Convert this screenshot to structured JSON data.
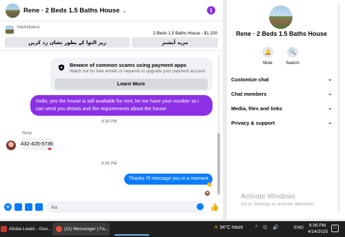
{
  "chat": {
    "title": "Rene · 2 Beds 1.5 Baths House",
    "chevron": "⌄",
    "info_icon": "i",
    "marketplace_label": "Marketplace",
    "listing_title": "2 Beds 1.5 Baths House - $1,150",
    "btn_mark_pending": "زیر التوا کے بطور نشان زد کریں",
    "btn_more_options": "مزید آپشنز",
    "scam_title": "Beware of common scams using payment apps",
    "scam_subtitle": "Watch out for fake emails or requests to upgrade your payment account.",
    "learn_more": "Learn More",
    "messages": {
      "out1": "Hello, yes the house is still available for rent, let me have your number so i can send you details and the requirements about the house",
      "ts1": "9:38 PM",
      "sender": "Rene",
      "in1": "432-425-5736",
      "heart": "❤",
      "ts2": "9:39 PM",
      "out2": "Thanks I'll message you in a moment",
      "clap": "👏"
    },
    "composer": {
      "placeholder": "Aa",
      "plus_icon": "+",
      "like_icon": "👍"
    }
  },
  "details": {
    "title": "Rene · 2 Beds 1.5 Baths House",
    "mute_label": "Mute",
    "search_label": "Search",
    "mute_icon": "🔔",
    "search_icon": "🔍",
    "sections": [
      {
        "label": "Customize chat",
        "chev": "⌄"
      },
      {
        "label": "Chat members",
        "chev": "⌄"
      },
      {
        "label": "Media, files and links",
        "chev": "⌄"
      },
      {
        "label": "Privacy & support",
        "chev": "⌄"
      }
    ],
    "activate_title": "Activate Windows",
    "activate_sub": "Go to Settings to activate Windows."
  },
  "taskbar": {
    "app1": "Alisba Leads - Goo...",
    "app2": "(11) Messenger | Fa...",
    "weather": "34°C  Haze",
    "sun": "☀",
    "tray": "^ ⊡ 🔊",
    "lang": "ENG",
    "time": "9:39 PM",
    "date": "4/14/2025",
    "notif": "□"
  },
  "colors": {
    "outgoing_purple": "#8c31e6",
    "outgoing_blue": "#0a7cff",
    "taskbar": "#202020"
  }
}
